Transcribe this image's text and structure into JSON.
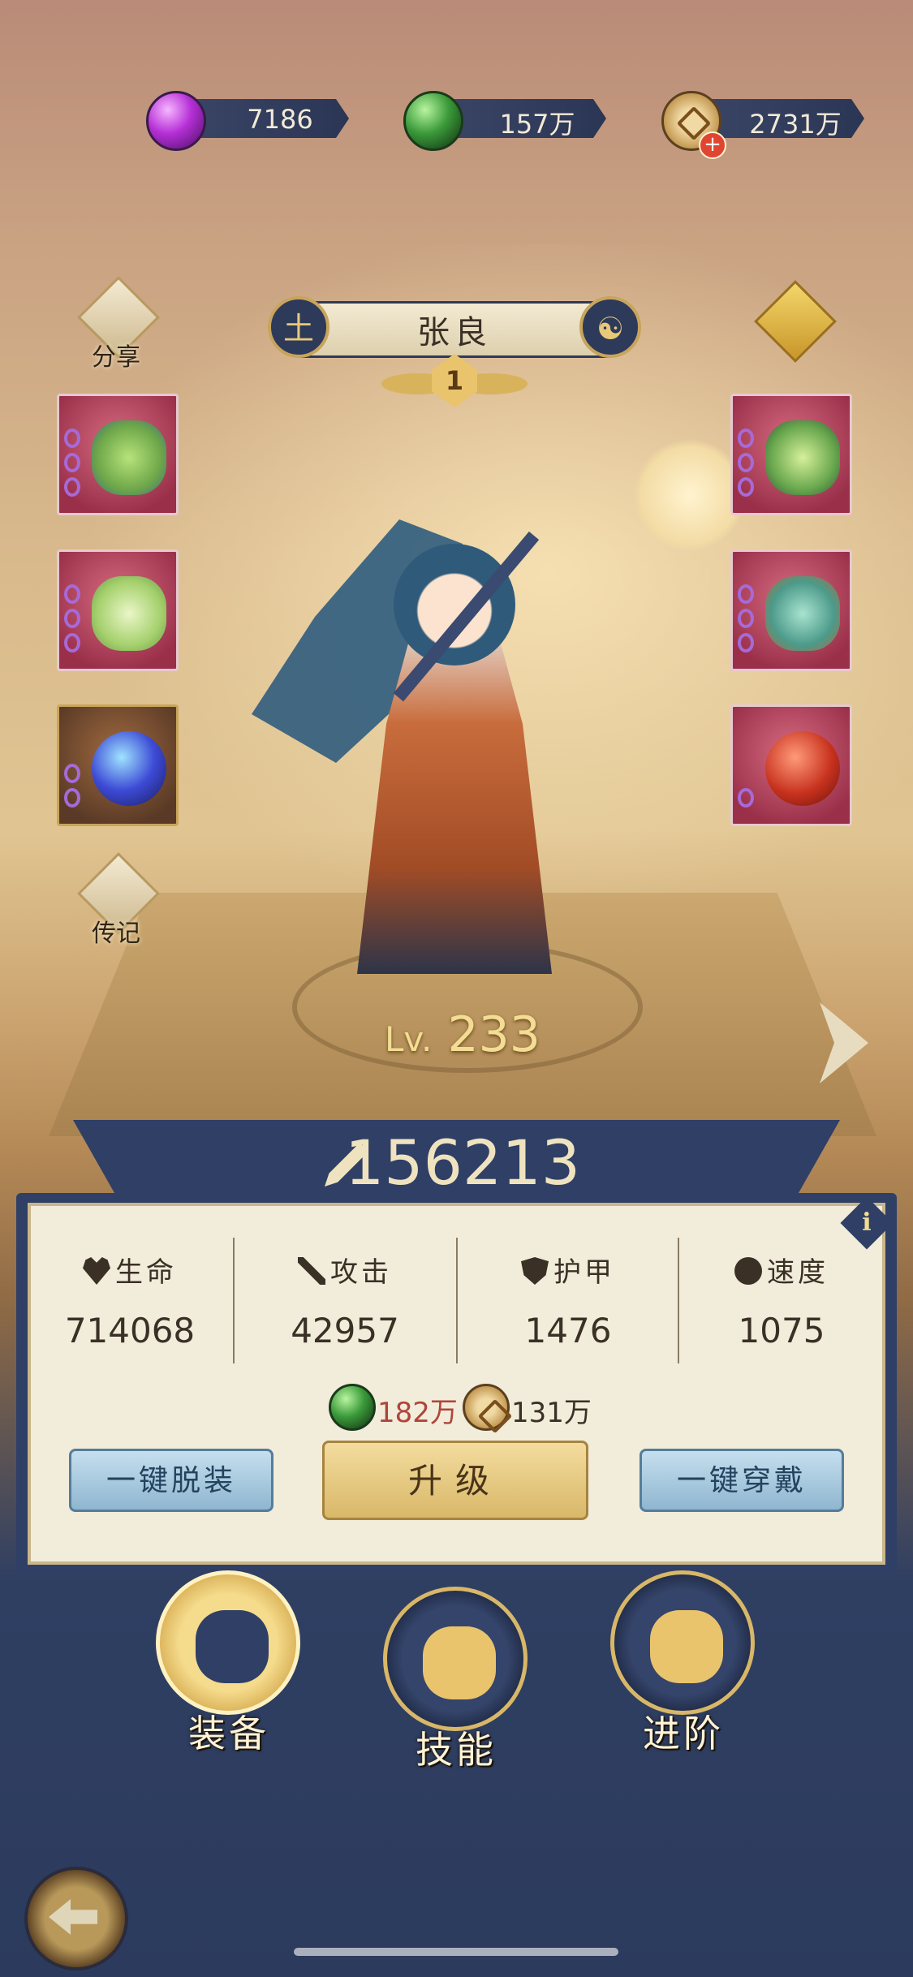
{
  "currencies": [
    {
      "icon": "purple-gem-icon",
      "value": "7186"
    },
    {
      "icon": "green-jade-icon",
      "value": "157万"
    },
    {
      "icon": "copper-coin-icon",
      "value": "2731万"
    }
  ],
  "hero": {
    "name": "张良",
    "element_glyph": "土",
    "star": "1",
    "level_prefix": "Lv.",
    "level": "233"
  },
  "side": {
    "share_label": "分享",
    "biography_label": "传记"
  },
  "power": "156213",
  "stats": [
    {
      "label": "生命",
      "icon": "heart-icon",
      "value": "714068"
    },
    {
      "label": "攻击",
      "icon": "crossed-swords-icon",
      "value": "42957"
    },
    {
      "label": "护甲",
      "icon": "shield-icon",
      "value": "1476"
    },
    {
      "label": "速度",
      "icon": "swirl-icon",
      "value": "1075"
    }
  ],
  "cost": [
    {
      "icon": "green-jade-icon",
      "value": "182万",
      "color": "#b0453a"
    },
    {
      "icon": "copper-coin-icon",
      "value": "131万",
      "color": "#3a3026"
    }
  ],
  "buttons": {
    "unequip_all": "一键脱装",
    "upgrade": "升级",
    "equip_all": "一键穿戴"
  },
  "tabs": [
    {
      "label": "装备",
      "active": true
    },
    {
      "label": "技能",
      "active": false
    },
    {
      "label": "进阶",
      "active": false
    }
  ],
  "info_label": "i"
}
